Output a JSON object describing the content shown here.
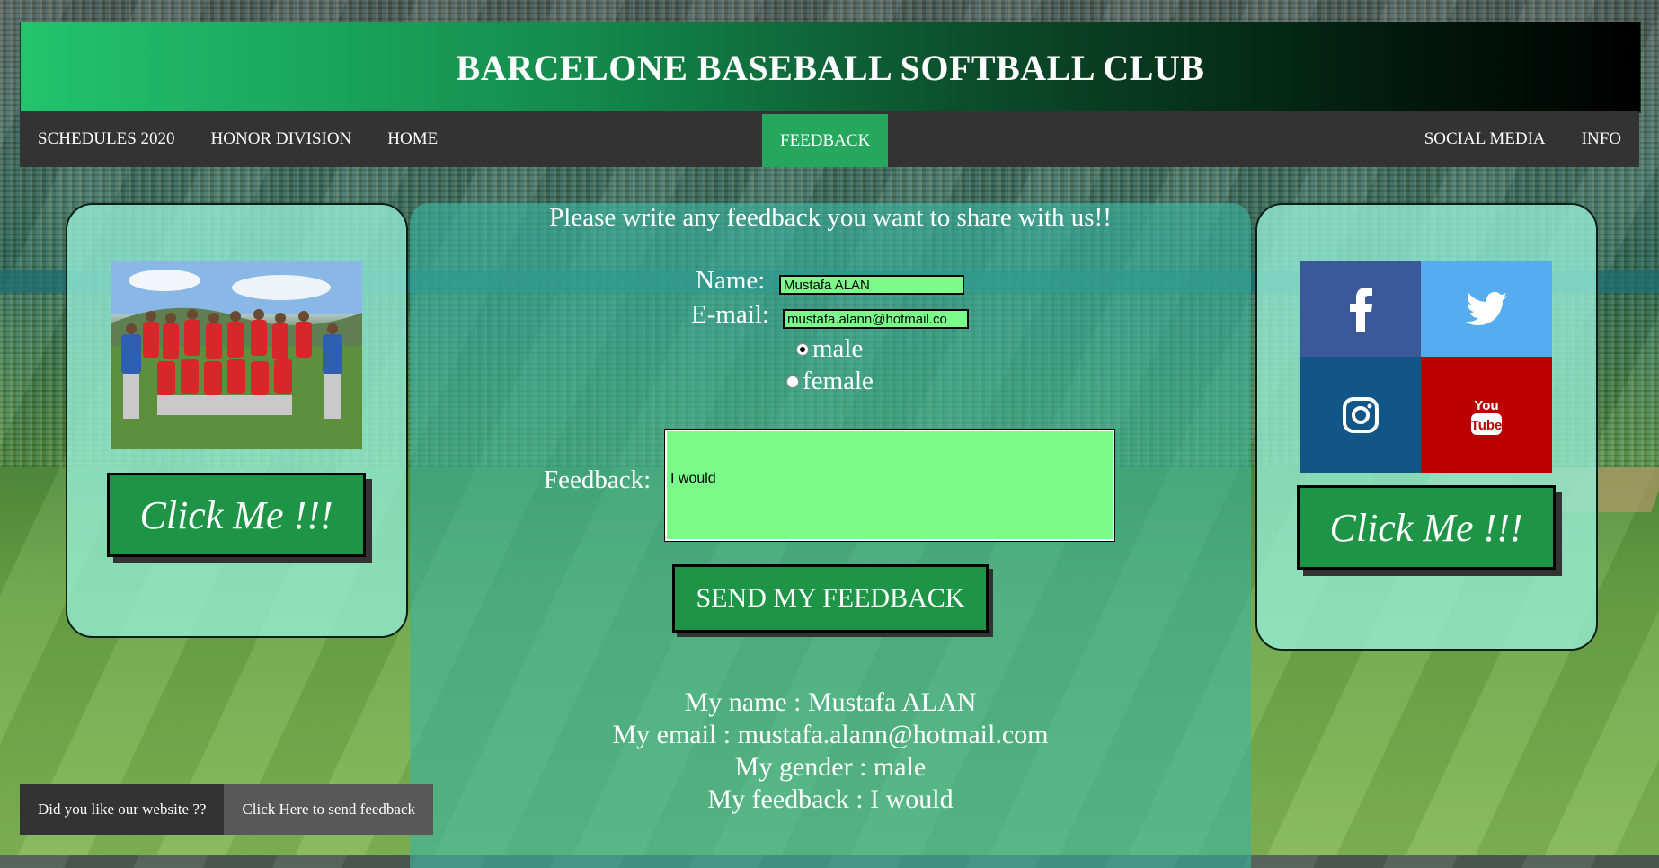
{
  "header": {
    "title": "BARCELONE BASEBALL SOFTBALL CLUB"
  },
  "nav": {
    "left_items": [
      "SCHEDULES 2020",
      "HONOR DIVISION",
      "HOME"
    ],
    "active": "FEEDBACK",
    "right_items": [
      "SOCIAL MEDIA",
      "INFO"
    ]
  },
  "left_panel": {
    "image_alt": "team-photo",
    "button_label": "Click Me !!!"
  },
  "right_panel": {
    "social_icons": [
      "facebook-icon",
      "twitter-icon",
      "instagram-icon",
      "youtube-icon"
    ],
    "button_label": "Click Me !!!"
  },
  "feedback": {
    "prompt": "Please write any feedback you want to share with us!!",
    "name_label": "Name:",
    "name_value": "Mustafa ALAN",
    "email_label": "E-mail:",
    "email_value": "mustafa.alann@hotmail.co",
    "gender_options": [
      "male",
      "female"
    ],
    "gender_selected": "male",
    "feedback_label": "Feedback:",
    "feedback_value": "I would",
    "send_label": "SEND MY FEEDBACK"
  },
  "summary": {
    "name_line": "My name : Mustafa ALAN",
    "email_line": "My email : mustafa.alann@hotmail.com",
    "gender_line": "My gender : male",
    "feedback_line": "My feedback : I would"
  },
  "bottom_bar": {
    "question": "Did you like our website ??",
    "button": "Click Here to send feedback"
  },
  "colors": {
    "accent": "#25a85d",
    "input_bg": "#7bfb8a",
    "nav_bg": "#333333"
  }
}
